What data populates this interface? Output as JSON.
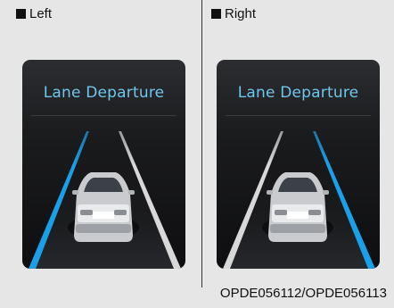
{
  "panels": [
    {
      "label": "Left",
      "title": "Lane Departure",
      "departure_side": "left"
    },
    {
      "label": "Right",
      "title": "Lane Departure",
      "departure_side": "right"
    }
  ],
  "caption": "OPDE056112/OPDE056113",
  "colors": {
    "warning_line": "#1aa0e8",
    "title": "#6fc6ee",
    "background": "#e6e6e6"
  },
  "icons": {
    "bullet": "black-square-icon",
    "vehicle": "car-rear-icon"
  }
}
